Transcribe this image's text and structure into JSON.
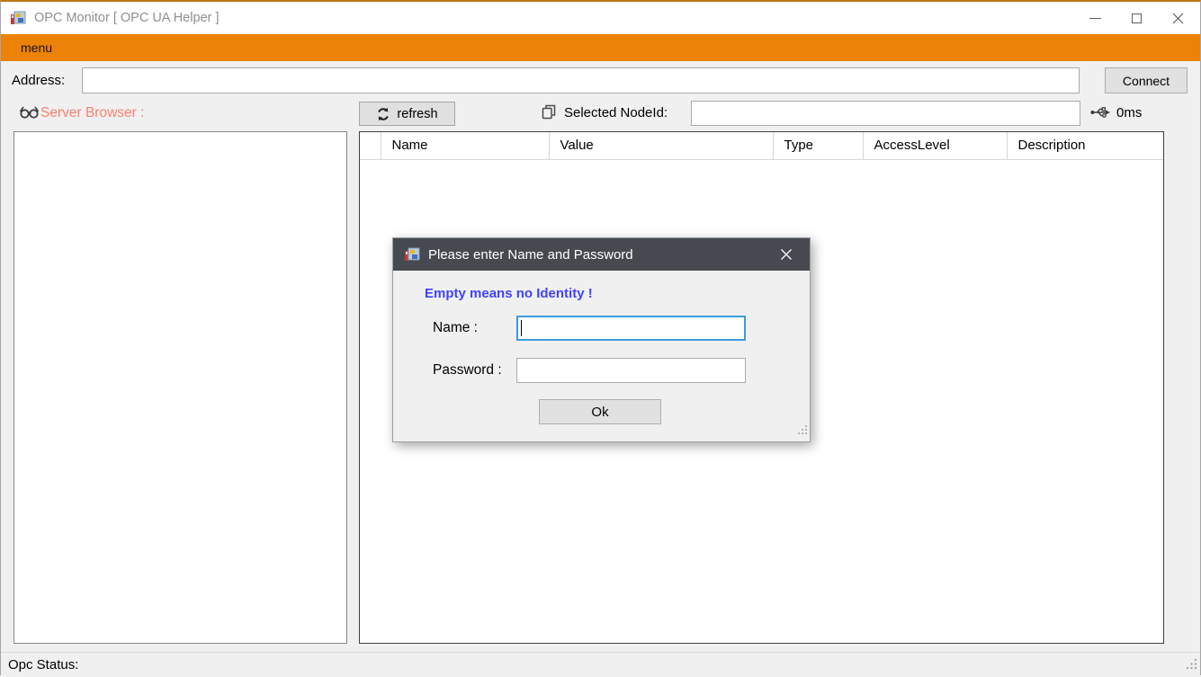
{
  "window": {
    "title": "OPC Monitor [ OPC UA Helper ]"
  },
  "menu_bar": {
    "items": [
      {
        "label": "menu"
      }
    ]
  },
  "toolbar": {
    "address_label": "Address:",
    "address_value": "",
    "connect_label": "Connect"
  },
  "browser": {
    "label": "Server Browser :"
  },
  "grid_toolbar": {
    "refresh_label": "refresh",
    "selected_nodeid_label": "Selected NodeId:",
    "selected_nodeid_value": "",
    "latency": "0ms"
  },
  "table": {
    "columns": [
      "Name",
      "Value",
      "Type",
      "AccessLevel",
      "Description"
    ],
    "rows": []
  },
  "dialog": {
    "title": "Please enter Name and Password",
    "hint": "Empty means no Identity !",
    "name_label": "Name :",
    "name_value": "",
    "password_label": "Password :",
    "password_value": "",
    "ok_label": "Ok"
  },
  "status_bar": {
    "label": "Opc Status:"
  },
  "colors": {
    "accent_orange": "#ED8208",
    "browser_label": "#FA8072",
    "dialog_header": "#464A50",
    "hint_text": "#4141FF",
    "focus_border": "#3D9BDE"
  }
}
